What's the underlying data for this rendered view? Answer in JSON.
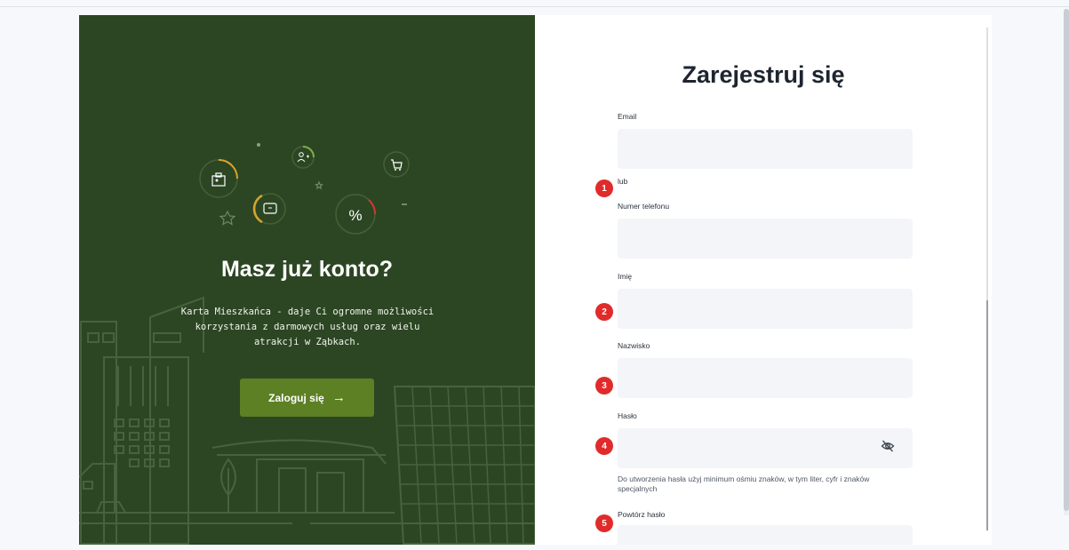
{
  "left": {
    "title": "Masz już konto?",
    "description": "Karta Mieszkańca - daje Ci ogromne możliwości korzystania z darmowych usług oraz wielu atrakcji w Ząbkach.",
    "login_button": "Zaloguj się",
    "login_arrow": "→",
    "icons": [
      "id-card-icon",
      "ticket-icon",
      "percent-icon",
      "add-user-icon",
      "cart-icon",
      "star-icon"
    ],
    "background": "#2c4623",
    "button_color": "#5c8023"
  },
  "form": {
    "title": "Zarejestruj się",
    "fields": {
      "email": {
        "label": "Email",
        "value": ""
      },
      "or": "lub",
      "phone": {
        "label": "Numer telefonu",
        "value": ""
      },
      "first_name": {
        "label": "Imię",
        "value": ""
      },
      "last_name": {
        "label": "Nazwisko",
        "value": ""
      },
      "password": {
        "label": "Hasło",
        "value": "",
        "toggle_icon": "eye-off-icon"
      },
      "password_hint": "Do utworzenia hasła użyj minimum ośmiu znaków, w tym liter, cyfr i znaków specjalnych",
      "password_repeat": {
        "label": "Powtórz hasło",
        "value": ""
      }
    }
  },
  "markers": [
    "1",
    "2",
    "3",
    "4",
    "5"
  ],
  "marker_color": "#e12b2b"
}
